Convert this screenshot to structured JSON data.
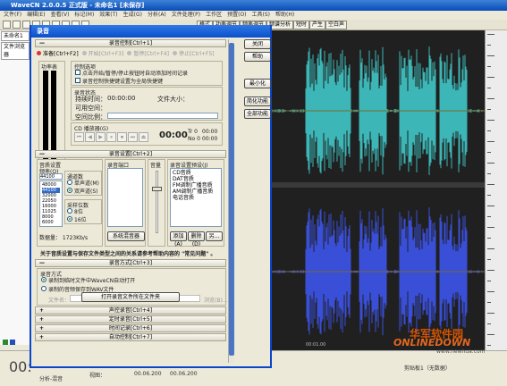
{
  "window": {
    "title": "WaveCN 2.0.0.5 正式版 - 未命名1 [未保存]"
  },
  "menu": [
    "文件(F)",
    "编辑(E)",
    "查看(V)",
    "标记(M)",
    "效果(T)",
    "生成(G)",
    "分析(A)",
    "文件处理(P)",
    "工作区",
    "预置(O)",
    "工具(S)",
    "帮助(H)"
  ],
  "toolbar": {
    "right_tabs": [
      "格式",
      "功率调节",
      "频率调节",
      "频谱分析",
      "短时",
      "产生",
      "空白声"
    ]
  },
  "left_panel": {
    "doc_tab": "未命名1",
    "browser_tab": "文件浏览器"
  },
  "dialog": {
    "title": "录音",
    "sec_control": "录音控制[Ctrl+1]",
    "tabs": [
      "准备[Ctrl+F2]",
      "开始[Ctrl+F3]",
      "暂停[Ctrl+F4]",
      "停止[Ctrl+F5]"
    ],
    "power_label": "功率表",
    "monitor_label": "监控",
    "ctrl_group": "控制选项",
    "opt1": "点击开始/暂停/停止按钮时自动添加时间记录",
    "opt2": "录音控制快捷键设置为全局快捷键",
    "status_group": "录音状态",
    "duration_label": "持续时间：",
    "duration_val": "00:00:00",
    "filesize_label": "文件大小：",
    "space_label": "可用空间：",
    "ratio_label": "空间比例：",
    "cd_label": "CD 播放器(G)",
    "cd_time": "00:00",
    "cd_track": "Tr 0",
    "cd_track_time": "00:00",
    "cd_no": "No 0",
    "cd_no_time": "00:00",
    "sec_settings": "录音设置[Ctrl+2]",
    "fmt_group": "音质设置",
    "freq_label": "频率(Q)",
    "freq_val": "44100",
    "freq_list": [
      "48000",
      "44100",
      "32000",
      "22050",
      "16000",
      "11025",
      "8000",
      "6000"
    ],
    "ch_group": "通道数",
    "ch_mono": "单声道(M)",
    "ch_stereo": "双声道(S)",
    "bits_group": "采样位数",
    "bits_8": "8位",
    "bits_16": "16位",
    "datarate": "数据量：  1723Kb/s",
    "port_group": "录音端口",
    "mixer_btn": "系统混音器",
    "vol_group": "音量",
    "preset_group": "录音设置预设(J)",
    "preset_items": [
      "CD音质",
      "DAT音质",
      "FM调制广播音质",
      "AM调制广播音质",
      "电话音质"
    ],
    "add_btn": "添加(A)",
    "del_btn": "删除(D)",
    "other_btn": "另...",
    "format_note": "关于音质设置与保存文件类型之间的关系请参考帮助内容的 \"常见问题\" 。",
    "sec_mode": "录音方式[Ctrl+3]",
    "mode_group": "录音方式",
    "mode1": "录制到临时文件中WaveCN自动打开",
    "mode2": "录制的音频保存到WAV文件",
    "file_label": "文件名：",
    "browse_btn": "浏览(B)...",
    "open_folder_btn": "打开录音文件所在文件夹",
    "sec_vad": "声控录音[Ctrl+4]",
    "sec_timer": "定时录音[Ctrl+5]",
    "sec_timelog": "时间记录[Ctrl+6]",
    "sec_auto": "自动控制[Ctrl+7]",
    "right_btns": [
      "关闭",
      "帮助",
      "最小化",
      "简化功能",
      "全部功能"
    ]
  },
  "bottom": {
    "time": "00:",
    "view_label": "视图：",
    "pos1": "00.06.200",
    "pos2": "00.06.200",
    "status1": "分析-混音",
    "status2": "剪贴板1（无数据）"
  },
  "watermark": {
    "brand_cn": "华军软件园",
    "brand_en": "ONLINEDOWN",
    "url": "www.newhua.com"
  },
  "wave_ruler": "00:01.00"
}
